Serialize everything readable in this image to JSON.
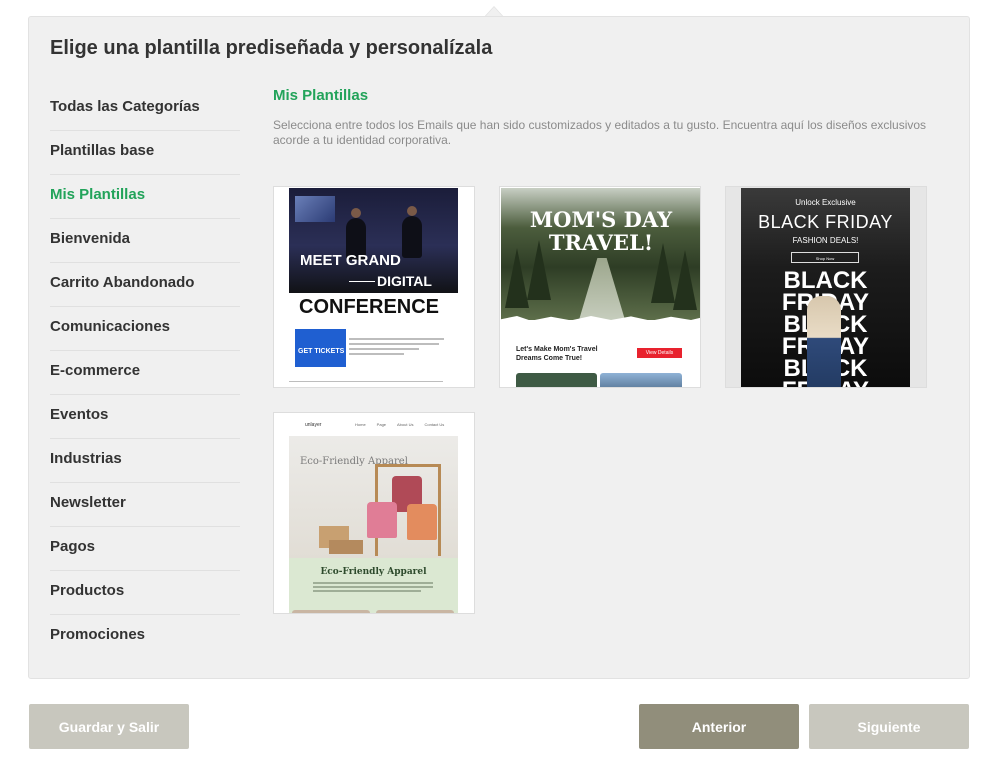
{
  "panel": {
    "title": "Elige una plantilla prediseñada y personalízala"
  },
  "sidebar": {
    "items": [
      {
        "label": "Todas las Categorías"
      },
      {
        "label": "Plantillas base"
      },
      {
        "label": "Mis Plantillas",
        "active": true
      },
      {
        "label": "Bienvenida"
      },
      {
        "label": "Carrito Abandonado"
      },
      {
        "label": "Comunicaciones"
      },
      {
        "label": "E-commerce"
      },
      {
        "label": "Eventos"
      },
      {
        "label": "Industrias"
      },
      {
        "label": "Newsletter"
      },
      {
        "label": "Pagos"
      },
      {
        "label": "Productos"
      },
      {
        "label": "Promociones"
      }
    ]
  },
  "content": {
    "title": "Mis Plantillas",
    "description": "Selecciona entre todos los Emails que han sido customizados y editados a tu gusto. Encuentra aquí los diseños exclusivos acorde a tu identidad corporativa."
  },
  "templates": [
    {
      "line1": "MEET GRAND",
      "line2": "DIGITAL",
      "line3": "CONFERENCE",
      "button": "GET TICKETS"
    },
    {
      "title": "MOM'S DAY TRAVEL!",
      "subtitle": "Let's Make Mom's Travel Dreams Come True!",
      "button": "View Details"
    },
    {
      "kicker": "Unlock Exclusive",
      "title": "BLACK FRIDAY",
      "deal": "FASHION DEALS!",
      "button": "Shop Now",
      "stack": "BLACK FRIDAY BLACK FRIDAY BLACK FRIDAY"
    },
    {
      "logo": "unlayer",
      "nav": [
        "Home",
        "Page",
        "About Us",
        "Contact Us"
      ],
      "hero": "Eco-Friendly Apparel",
      "title": "Eco-Friendly Apparel"
    }
  ],
  "footer": {
    "save_exit": "Guardar y Salir",
    "previous": "Anterior",
    "next": "Siguiente"
  },
  "colors": {
    "accent_green": "#22a35a",
    "button_primary": "#918e7b",
    "button_muted": "#c8c7be"
  }
}
